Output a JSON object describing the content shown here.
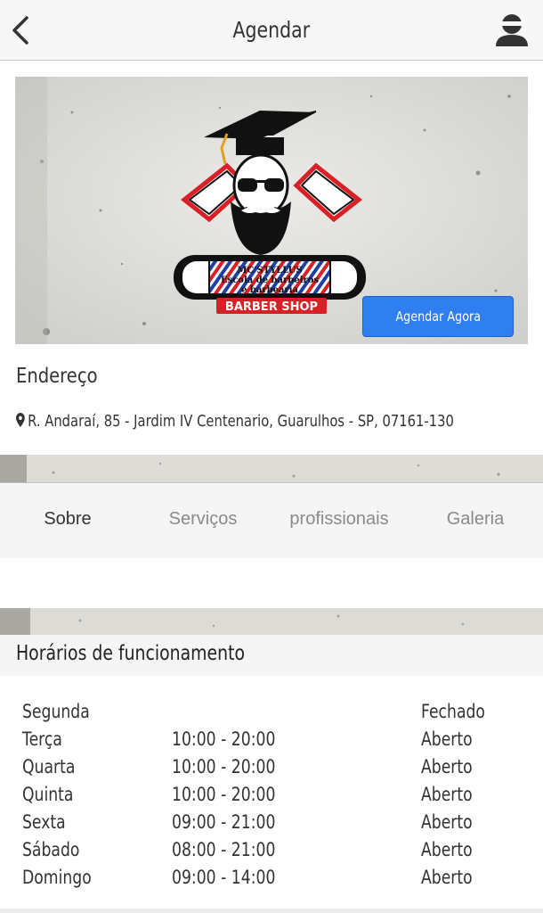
{
  "header": {
    "title": "Agendar"
  },
  "banner": {
    "logo_line1": "MC'STYLLUS",
    "logo_line2": "Escola de barbeiros",
    "logo_line3": "e barbearia",
    "logo_ribbon": "BARBER SHOP",
    "book_button": "Agendar Agora"
  },
  "address": {
    "label": "Endereço",
    "text": "R. Andaraí, 85 - Jardim IV Centenario, Guarulhos - SP, 07161-130"
  },
  "tabs": [
    {
      "label": "Sobre",
      "active": true
    },
    {
      "label": "Serviços",
      "active": false
    },
    {
      "label": "profissionais",
      "active": false
    },
    {
      "label": "Galeria",
      "active": false
    }
  ],
  "hours": {
    "title": "Horários de funcionamento",
    "rows": [
      {
        "day": "Segunda",
        "time": "",
        "status": "Fechado"
      },
      {
        "day": "Terça",
        "time": "10:00 - 20:00",
        "status": "Aberto"
      },
      {
        "day": "Quarta",
        "time": "10:00 - 20:00",
        "status": "Aberto"
      },
      {
        "day": "Quinta",
        "time": "10:00 - 20:00",
        "status": "Aberto"
      },
      {
        "day": "Sexta",
        "time": "09:00 - 21:00",
        "status": "Aberto"
      },
      {
        "day": "Sábado",
        "time": "08:00 - 21:00",
        "status": "Aberto"
      },
      {
        "day": "Domingo",
        "time": "09:00 - 14:00",
        "status": "Aberto"
      }
    ]
  },
  "colors": {
    "accent": "#2f7ff0",
    "logo_red": "#d92027",
    "stripe_blue": "#1f3fa8"
  },
  "icons": {
    "back": "chevron-left-icon",
    "user": "user-icon",
    "pin": "map-pin-icon"
  }
}
